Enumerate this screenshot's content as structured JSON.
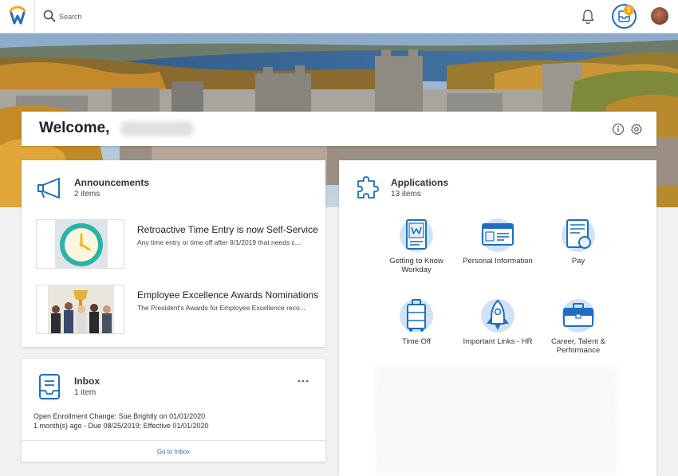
{
  "topbar": {
    "search_placeholder": "Search",
    "inbox_badge_count": "1",
    "icons": {
      "logo": "workday-logo",
      "search": "search-icon",
      "bell": "bell-icon",
      "inbox": "inbox-tray-icon"
    }
  },
  "welcome": {
    "greeting": "Welcome,"
  },
  "announcements": {
    "title": "Announcements",
    "count": "2 items",
    "items": [
      {
        "title": "Retroactive Time Entry is now Self-Service",
        "description": "Any time entry or time off after 8/1/2019 that needs c..."
      },
      {
        "title": "Employee Excellence Awards Nominations",
        "description": "The President's Awards for Employee Excellence reco..."
      }
    ]
  },
  "inbox": {
    "title": "Inbox",
    "count": "1 item",
    "message_line1": "Open Enrollment Change: Sue Brightly on 01/01/2020",
    "message_line2": "1 month(s) ago - Due 08/25/2019; Effective 01/01/2020",
    "footer_link": "Go to Inbox"
  },
  "applications": {
    "title": "Applications",
    "count": "13 items",
    "items": [
      {
        "label": "Getting to Know Workday",
        "icon": "workday-tablet-icon"
      },
      {
        "label": "Personal Information",
        "icon": "id-card-icon"
      },
      {
        "label": "Pay",
        "icon": "payslip-icon"
      },
      {
        "label": "Time Off",
        "icon": "suitcase-icon"
      },
      {
        "label": "Important Links - HR",
        "icon": "rocket-icon"
      },
      {
        "label": "Career, Talent & Performance",
        "icon": "briefcase-icon"
      }
    ]
  },
  "colors": {
    "accent": "#1f6ec2",
    "badge": "#f5a623",
    "icon_light_blue": "#cfe3f7"
  }
}
